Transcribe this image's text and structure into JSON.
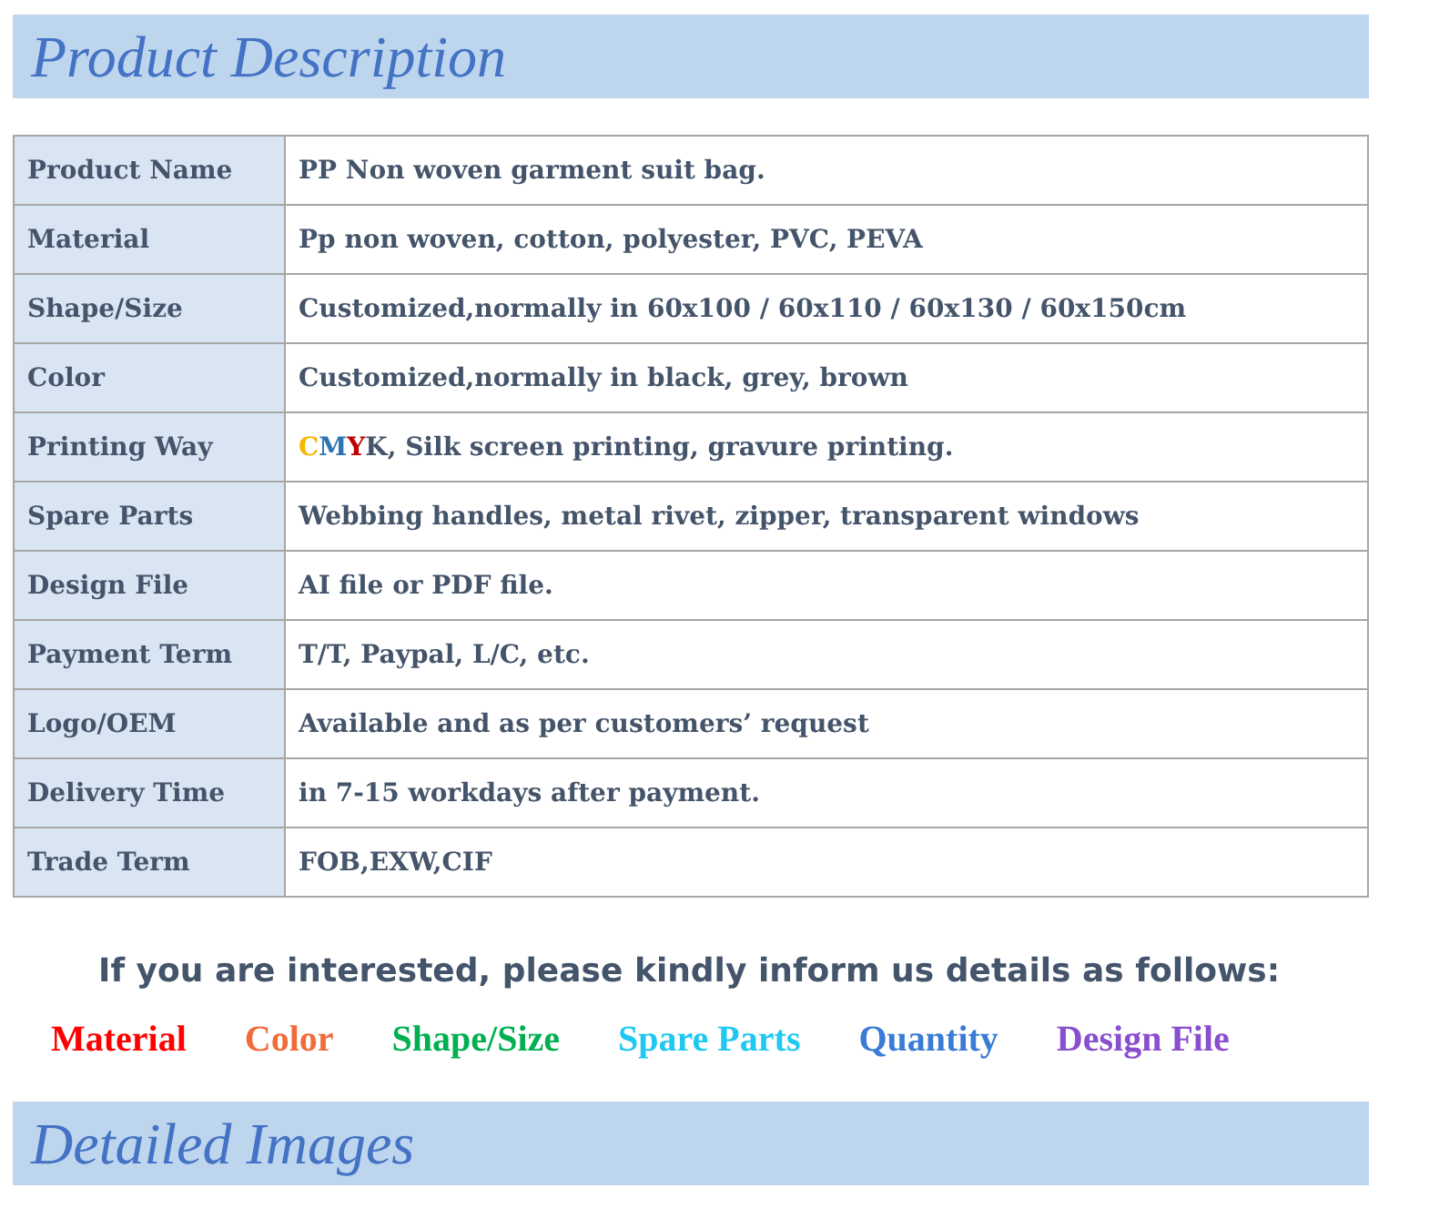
{
  "title": "Product Description",
  "table": {
    "rows": [
      {
        "label": "Product Name",
        "value": "PP Non woven garment suit bag."
      },
      {
        "label": "Material",
        "value": "Pp non woven, cotton, polyester, PVC, PEVA"
      },
      {
        "label": "Shape/Size",
        "value": "Customized,normally in 60x100 / 60x110 / 60x130 / 60x150cm"
      },
      {
        "label": "Color",
        "value": "Customized,normally in black, grey, brown"
      },
      {
        "label": "Printing Way",
        "segments": [
          {
            "text": "C",
            "color": "#f5b800"
          },
          {
            "text": "M",
            "color": "#2e75b6"
          },
          {
            "text": "Y",
            "color": "#c00000"
          },
          {
            "text": "K, Silk screen printing, gravure printing.",
            "color": "#44546a"
          }
        ]
      },
      {
        "label": "Spare Parts",
        "value": "Webbing handles, metal rivet, zipper, transparent windows"
      },
      {
        "label": "Design File",
        "value": "AI file or PDF file."
      },
      {
        "label": "Payment Term",
        "value": "T/T, Paypal, L/C, etc."
      },
      {
        "label": "Logo/OEM",
        "value": "Available and as per customers’ request"
      },
      {
        "label": "Delivery Time",
        "value": "in 7-15 workdays after payment."
      },
      {
        "label": "Trade Term",
        "value": "FOB,EXW,CIF"
      }
    ]
  },
  "notice": "If you are interested, please kindly inform us details as follows:",
  "details": [
    {
      "label": "Material",
      "color": "#ff0000"
    },
    {
      "label": "Color",
      "color": "#f26b3a"
    },
    {
      "label": "Shape/Size",
      "color": "#00b050"
    },
    {
      "label": "Spare Parts",
      "color": "#1fc8f0"
    },
    {
      "label": "Quantity",
      "color": "#3a7bd5"
    },
    {
      "label": "Design File",
      "color": "#8a4fcf"
    }
  ],
  "section_title": "Detailed Images"
}
